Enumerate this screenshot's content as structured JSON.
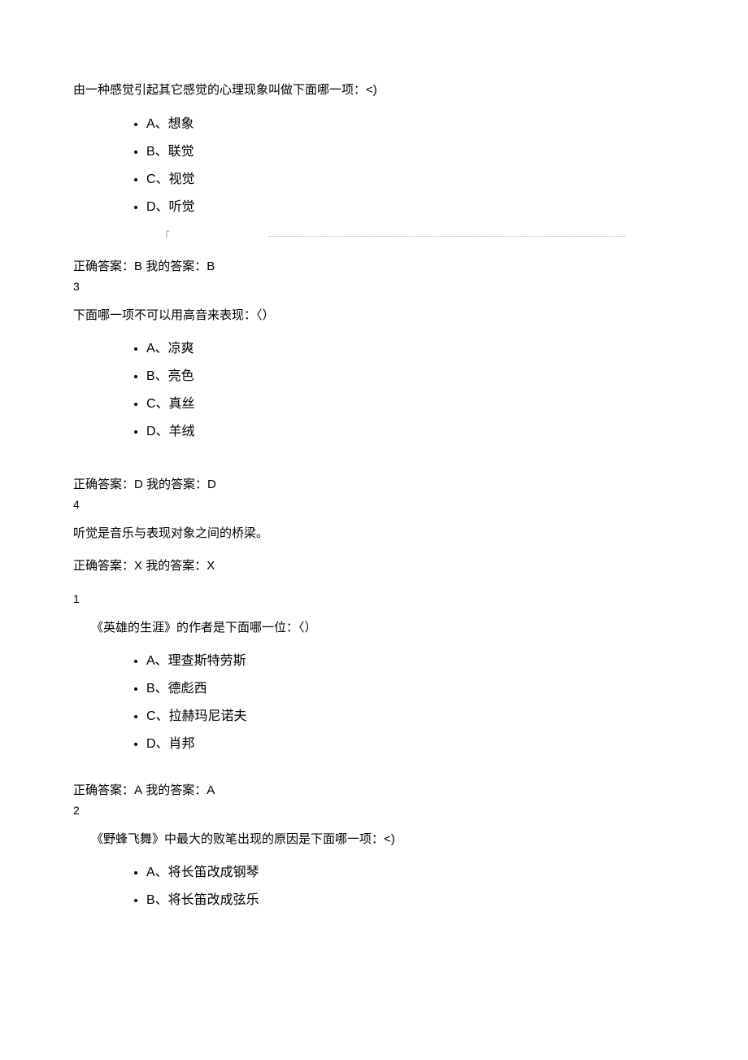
{
  "q2": {
    "prompt": "由一种感觉引起其它感觉的心理现象叫做下面哪一项：<)",
    "options": {
      "A": "A、想象",
      "B": "B、联觉",
      "C": "C、视觉",
      "D": "D、听觉"
    },
    "correct_label": "正确答案：",
    "correct": "B",
    "my_label": " 我的答案：",
    "my": "B"
  },
  "q3": {
    "num": "3",
    "prompt": "下面哪一项不可以用高音来表现：〈）",
    "options": {
      "A": "A、凉爽",
      "B": "B、亮色",
      "C": "C、真丝",
      "D": "D、羊绒"
    },
    "correct_label": "正确答案：",
    "correct": "D",
    "my_label": " 我的答案：",
    "my": "D"
  },
  "q4": {
    "num": "4",
    "prompt": "听觉是音乐与表现对象之间的桥梁。",
    "correct_label": "正确答案：",
    "correct": "X",
    "my_label": " 我的答案：",
    "my": "X"
  },
  "q1b": {
    "num": "1",
    "prompt": "《英雄的生涯》的作者是下面哪一位：〈）",
    "options": {
      "A": "A、理查斯特劳斯",
      "B": "B、德彪西",
      "C": "C、拉赫玛尼诺夫",
      "D": "D、肖邦"
    },
    "correct_label": "正确答案：",
    "correct": "A",
    "my_label": " 我的答案：",
    "my": "A"
  },
  "q2b": {
    "num": "2",
    "prompt": "《野蜂飞舞》中最大的败笔出现的原因是下面哪一项：<)",
    "options": {
      "A": "A、将长笛改成钢琴",
      "B": "B、将长笛改成弦乐"
    }
  }
}
